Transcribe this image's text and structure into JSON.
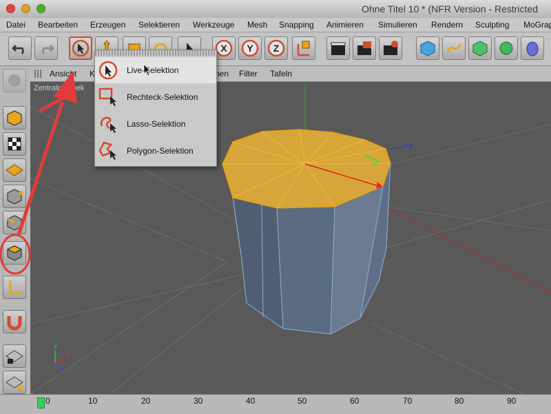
{
  "window": {
    "title": "Ohne Titel 10 * (NFR Version - Restricted"
  },
  "menubar": {
    "items": [
      "Datei",
      "Bearbeiten",
      "Erzeugen",
      "Selektieren",
      "Werkzeuge",
      "Mesh",
      "Snapping",
      "Animieren",
      "Simulieren",
      "Rendern",
      "Sculpting",
      "MoGrap"
    ]
  },
  "toolbar": {
    "axis_x": "X",
    "axis_y": "Y",
    "axis_z": "Z"
  },
  "viewport_menu": {
    "items": [
      "Ansicht",
      "K",
      "nen",
      "Filter",
      "Tafeln"
    ]
  },
  "viewport": {
    "label": "Zentralperspek"
  },
  "selection_menu": {
    "items": [
      "Live-Selektion",
      "Rechteck-Selektion",
      "Lasso-Selektion",
      "Polygon-Selektion"
    ],
    "highlighted": 0
  },
  "axis_gizmo": {
    "x": "X",
    "y": "Y",
    "z": "Z"
  },
  "timeline": {
    "ticks": [
      "0",
      "10",
      "20",
      "30",
      "40",
      "50",
      "60",
      "70",
      "80",
      "90"
    ]
  },
  "colors": {
    "accent": "#d34a2f",
    "selection_face": "#d6a63a",
    "object": "#5e6f85",
    "handle": "#35d05a"
  }
}
